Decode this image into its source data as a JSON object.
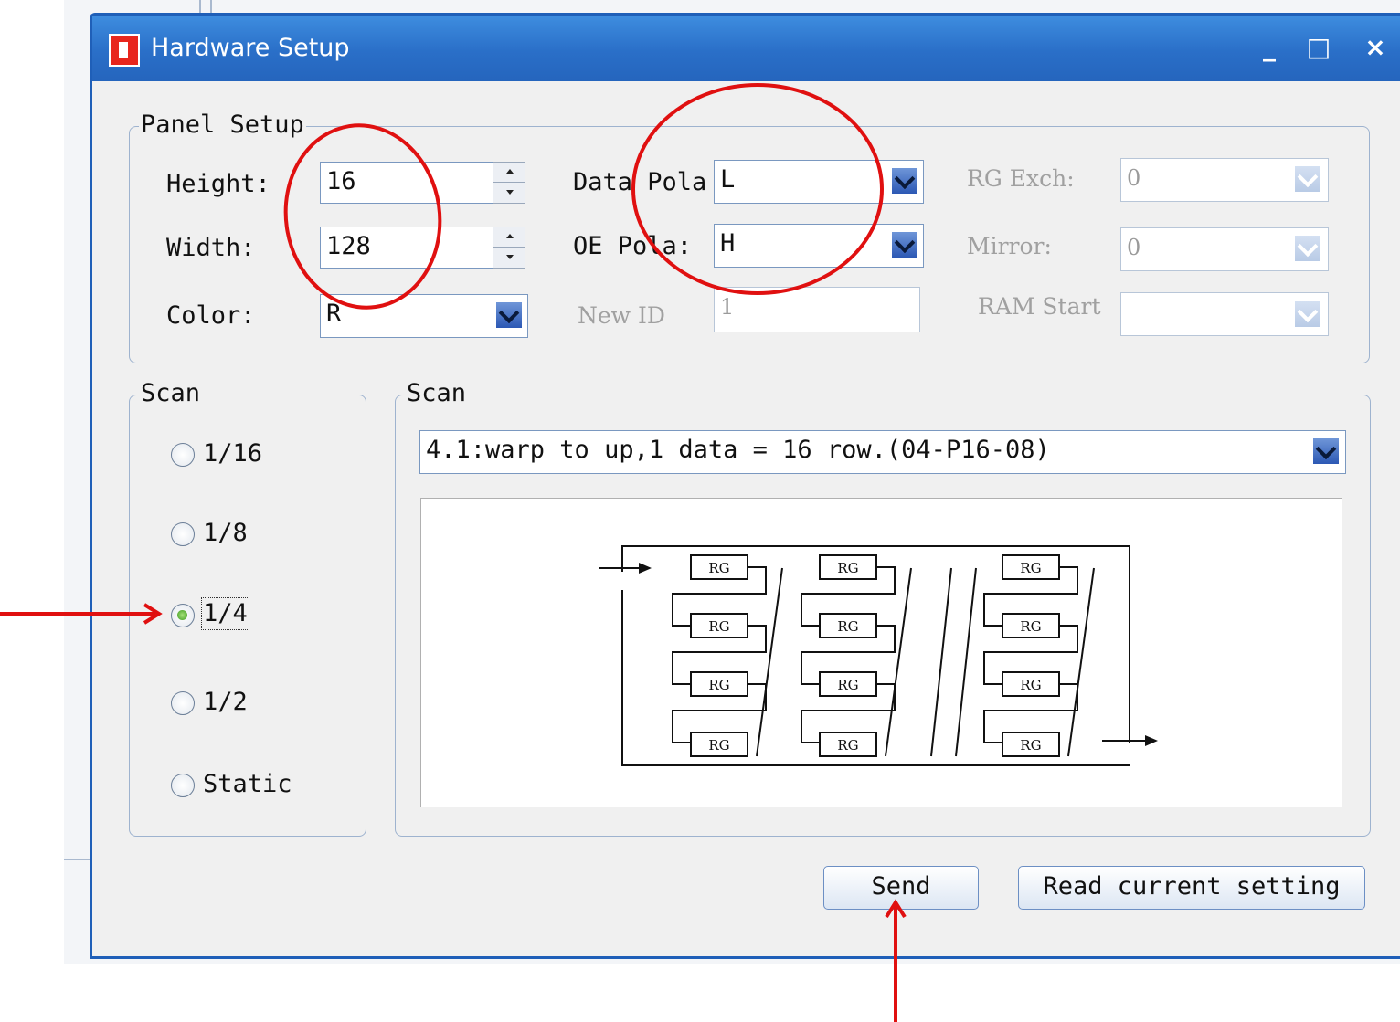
{
  "window": {
    "title": "Hardware Setup"
  },
  "panel_setup": {
    "legend": "Panel Setup",
    "height": {
      "label": "Height:",
      "value": "16"
    },
    "width": {
      "label": "Width:",
      "value": "128"
    },
    "color": {
      "label": "Color:",
      "value": "R"
    },
    "data_pola": {
      "label": "Data Pola",
      "value": "L"
    },
    "oe_pola": {
      "label": "OE Pola:",
      "value": "H"
    },
    "new_id": {
      "label": "New ID",
      "value": "1"
    },
    "rg_exch": {
      "label": "RG Exch:",
      "value": "0"
    },
    "mirror": {
      "label": "Mirror:",
      "value": "0"
    },
    "ram_start": {
      "label": "RAM Start",
      "value": ""
    }
  },
  "scan_options": {
    "legend": "Scan",
    "options": [
      "1/16",
      "1/8",
      "1/4",
      "1/2",
      "Static"
    ],
    "selected": "1/4"
  },
  "scan_mode": {
    "legend": "Scan",
    "selected": "4.1:warp to up,1 data = 16 row.(04-P16-08)",
    "module_label": "RG"
  },
  "buttons": {
    "send": "Send",
    "read": "Read current setting"
  },
  "colors": {
    "titlebar": "#2a6fc8",
    "annotation": "#e01010"
  }
}
